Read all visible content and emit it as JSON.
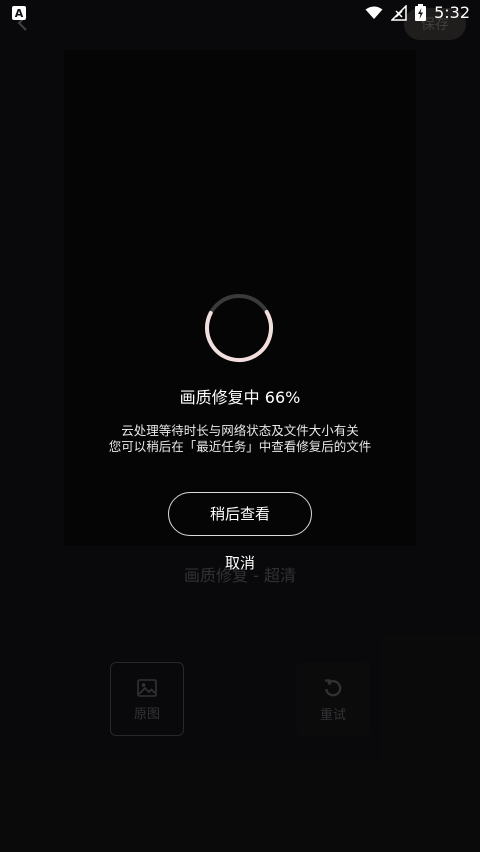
{
  "status_bar": {
    "time": "5:32",
    "left_icon": "A"
  },
  "top_bar": {
    "save_label": "保存"
  },
  "editor": {
    "mode_label": "画质修复 - 超清",
    "tools": [
      {
        "label": "原图",
        "icon": "image-icon"
      },
      {
        "label": "重试",
        "icon": "refresh-icon"
      }
    ]
  },
  "dialog": {
    "progress_text": "画质修复中 66%",
    "progress_value": 0.66,
    "hint_line1": "云处理等待时长与网络状态及文件大小有关",
    "hint_line2": "您可以稍后在「最近任务」中查看修复后的文件",
    "later_button": "稍后查看",
    "cancel_button": "取消"
  }
}
